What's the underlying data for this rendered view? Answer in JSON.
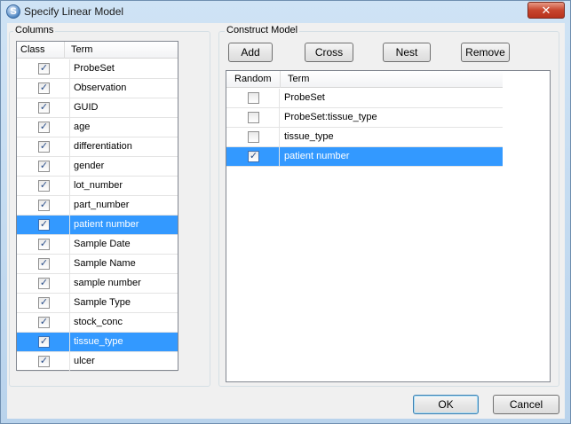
{
  "window": {
    "title": "Specify Linear Model",
    "app_icon_glyph": "S",
    "close_glyph": "✕"
  },
  "columns": {
    "label": "Columns",
    "header_class": "Class",
    "header_term": "Term",
    "selected_color": "#3399ff",
    "items": [
      {
        "term": "ProbeSet",
        "checked": true,
        "selected": false
      },
      {
        "term": "Observation",
        "checked": true,
        "selected": false
      },
      {
        "term": "GUID",
        "checked": true,
        "selected": false
      },
      {
        "term": "age",
        "checked": true,
        "selected": false
      },
      {
        "term": "differentiation",
        "checked": true,
        "selected": false
      },
      {
        "term": "gender",
        "checked": true,
        "selected": false
      },
      {
        "term": "lot_number",
        "checked": true,
        "selected": false
      },
      {
        "term": "part_number",
        "checked": true,
        "selected": false
      },
      {
        "term": "patient number",
        "checked": true,
        "selected": true
      },
      {
        "term": "Sample Date",
        "checked": true,
        "selected": false
      },
      {
        "term": "Sample Name",
        "checked": true,
        "selected": false
      },
      {
        "term": "sample number",
        "checked": true,
        "selected": false
      },
      {
        "term": "Sample Type",
        "checked": true,
        "selected": false
      },
      {
        "term": "stock_conc",
        "checked": true,
        "selected": false
      },
      {
        "term": "tissue_type",
        "checked": true,
        "selected": true
      },
      {
        "term": "ulcer",
        "checked": true,
        "selected": false
      }
    ]
  },
  "construct": {
    "label": "Construct Model",
    "buttons": {
      "add": "Add",
      "cross": "Cross",
      "nest": "Nest",
      "remove": "Remove"
    },
    "header_random": "Random",
    "header_term": "Term",
    "items": [
      {
        "term": "ProbeSet",
        "checked": false,
        "selected": false
      },
      {
        "term": "ProbeSet:tissue_type",
        "checked": false,
        "selected": false
      },
      {
        "term": "tissue_type",
        "checked": false,
        "selected": false
      },
      {
        "term": "patient number",
        "checked": true,
        "selected": true
      }
    ]
  },
  "footer": {
    "ok": "OK",
    "cancel": "Cancel"
  }
}
